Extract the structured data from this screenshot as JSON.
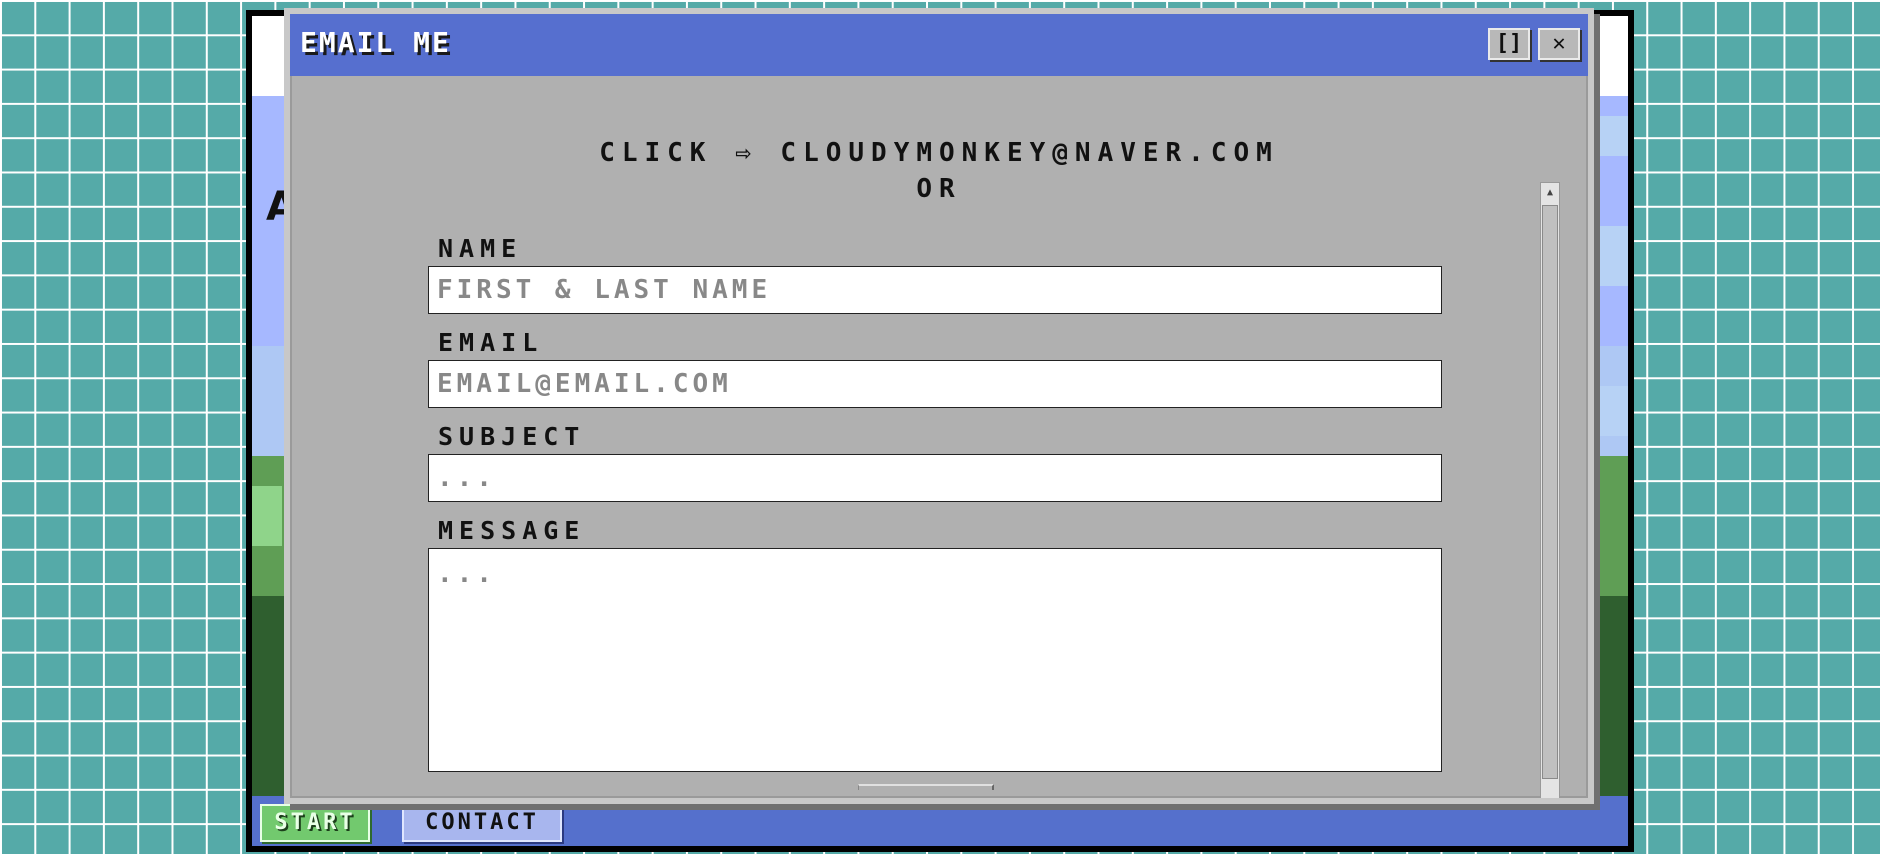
{
  "dialog": {
    "title": "EMAIL ME",
    "maximize_glyph": "[]",
    "close_glyph": "✕",
    "click_prefix": "CLICK ⇨ ",
    "email_link": "CLOUDYMONKEY@NAVER.COM",
    "or_text": "OR"
  },
  "form": {
    "name_label": "NAME",
    "name_placeholder": "FIRST & LAST NAME",
    "email_label": "EMAIL",
    "email_placeholder": "EMAIL@EMAIL.COM",
    "subject_label": "SUBJECT",
    "subject_placeholder": "...",
    "message_label": "MESSAGE",
    "message_placeholder": "..."
  },
  "desktop": {
    "partial_letter": "A"
  },
  "taskbar": {
    "start_label": "START",
    "contact_label": "CONTACT"
  },
  "icons": {
    "scroll_up": "▲",
    "scroll_down": "▼"
  }
}
